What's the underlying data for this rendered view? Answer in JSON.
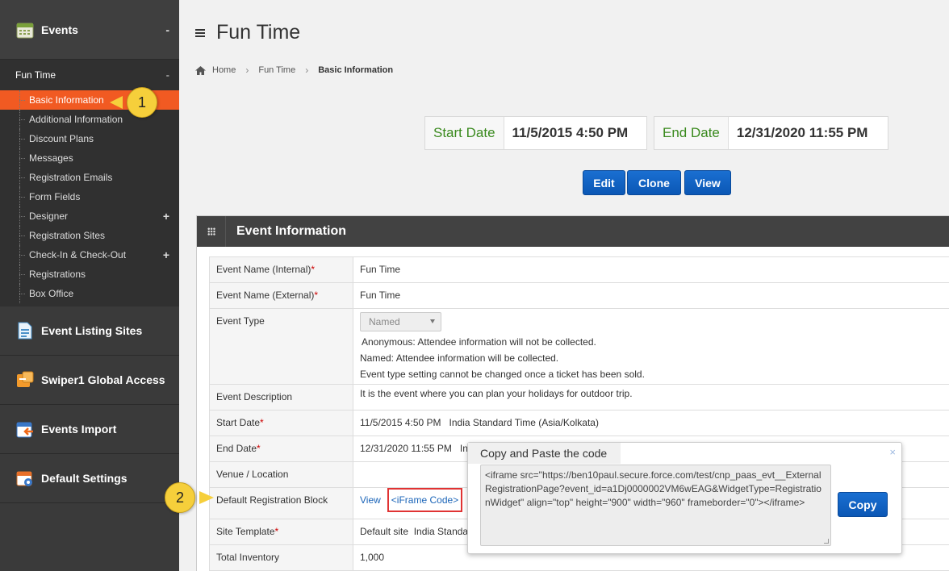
{
  "sidebar": {
    "events_section": {
      "label": "Events",
      "toggle": "-"
    },
    "fun_time": {
      "label": "Fun Time",
      "toggle": "-"
    },
    "items": [
      {
        "label": "Basic Information",
        "active": true
      },
      {
        "label": "Additional Information"
      },
      {
        "label": "Discount Plans"
      },
      {
        "label": "Messages"
      },
      {
        "label": "Registration Emails"
      },
      {
        "label": "Form Fields"
      },
      {
        "label": "Designer",
        "toggle": "+"
      },
      {
        "label": "Registration Sites"
      },
      {
        "label": "Check-In & Check-Out",
        "toggle": "+"
      },
      {
        "label": "Registrations"
      },
      {
        "label": "Box Office"
      }
    ],
    "sections": [
      {
        "label": "Event Listing Sites",
        "icon": "listing-icon"
      },
      {
        "label": "Swiper1 Global Access",
        "icon": "swiper-icon"
      },
      {
        "label": "Events Import",
        "icon": "import-icon"
      },
      {
        "label": "Default Settings",
        "icon": "settings-calendar-icon"
      }
    ]
  },
  "header": {
    "title": "Fun Time",
    "breadcrumb": [
      "Home",
      "Fun Time",
      "Basic Information"
    ]
  },
  "dates": {
    "start_label": "Start Date",
    "start_value": "11/5/2015 4:50 PM",
    "end_label": "End Date",
    "end_value": "12/31/2020 11:55 PM"
  },
  "actions": {
    "edit": "Edit",
    "clone": "Clone",
    "view": "View"
  },
  "panel": {
    "title": "Event Information",
    "rows": {
      "name_internal": {
        "label": "Event Name (Internal)",
        "req": "*",
        "value": "Fun Time"
      },
      "name_external": {
        "label": "Event Name (External)",
        "req": "*",
        "value": "Fun Time"
      },
      "event_type": {
        "label": "Event Type",
        "selected": "Named",
        "note1": "Anonymous: Attendee information will not be collected.",
        "note2": "Named: Attendee information will be collected.",
        "note3": "Event type setting cannot be changed once a ticket has been sold."
      },
      "description": {
        "label": "Event Description",
        "value": "It is the event where you can plan your holidays for outdoor trip."
      },
      "start_date": {
        "label": "Start Date",
        "req": "*",
        "value": "11/5/2015 4:50 PM   India Standard Time (Asia/Kolkata)"
      },
      "end_date": {
        "label": "End Date",
        "req": "*",
        "value": "12/31/2020 11:55 PM   In"
      },
      "venue": {
        "label": "Venue / Location",
        "value": ""
      },
      "reg_block": {
        "label": "Default Registration Block",
        "view": "View",
        "iframe": "<iFrame Code>"
      },
      "site_template": {
        "label": "Site Template",
        "req": "*",
        "value": "Default site  India Standa"
      },
      "inventory": {
        "label": "Total Inventory",
        "value": "1,000"
      }
    }
  },
  "popup": {
    "title": "Copy and Paste the code",
    "close": "×",
    "code": "<iframe src=\"https://ben10paul.secure.force.com/test/cnp_paas_evt__ExternalRegistrationPage?event_id=a1Dj0000002VM6wEAG&WidgetType=RegistrationWidget\" align=\"top\" height=\"900\" width=\"960\" frameborder=\"0\"></iframe>",
    "copy": "Copy"
  },
  "callouts": {
    "one": "1",
    "two": "2"
  },
  "colors": {
    "accent": "#f15a22",
    "button": "#0b57b5",
    "date_label": "#3a8a1e",
    "callout": "#f6cf3b"
  }
}
